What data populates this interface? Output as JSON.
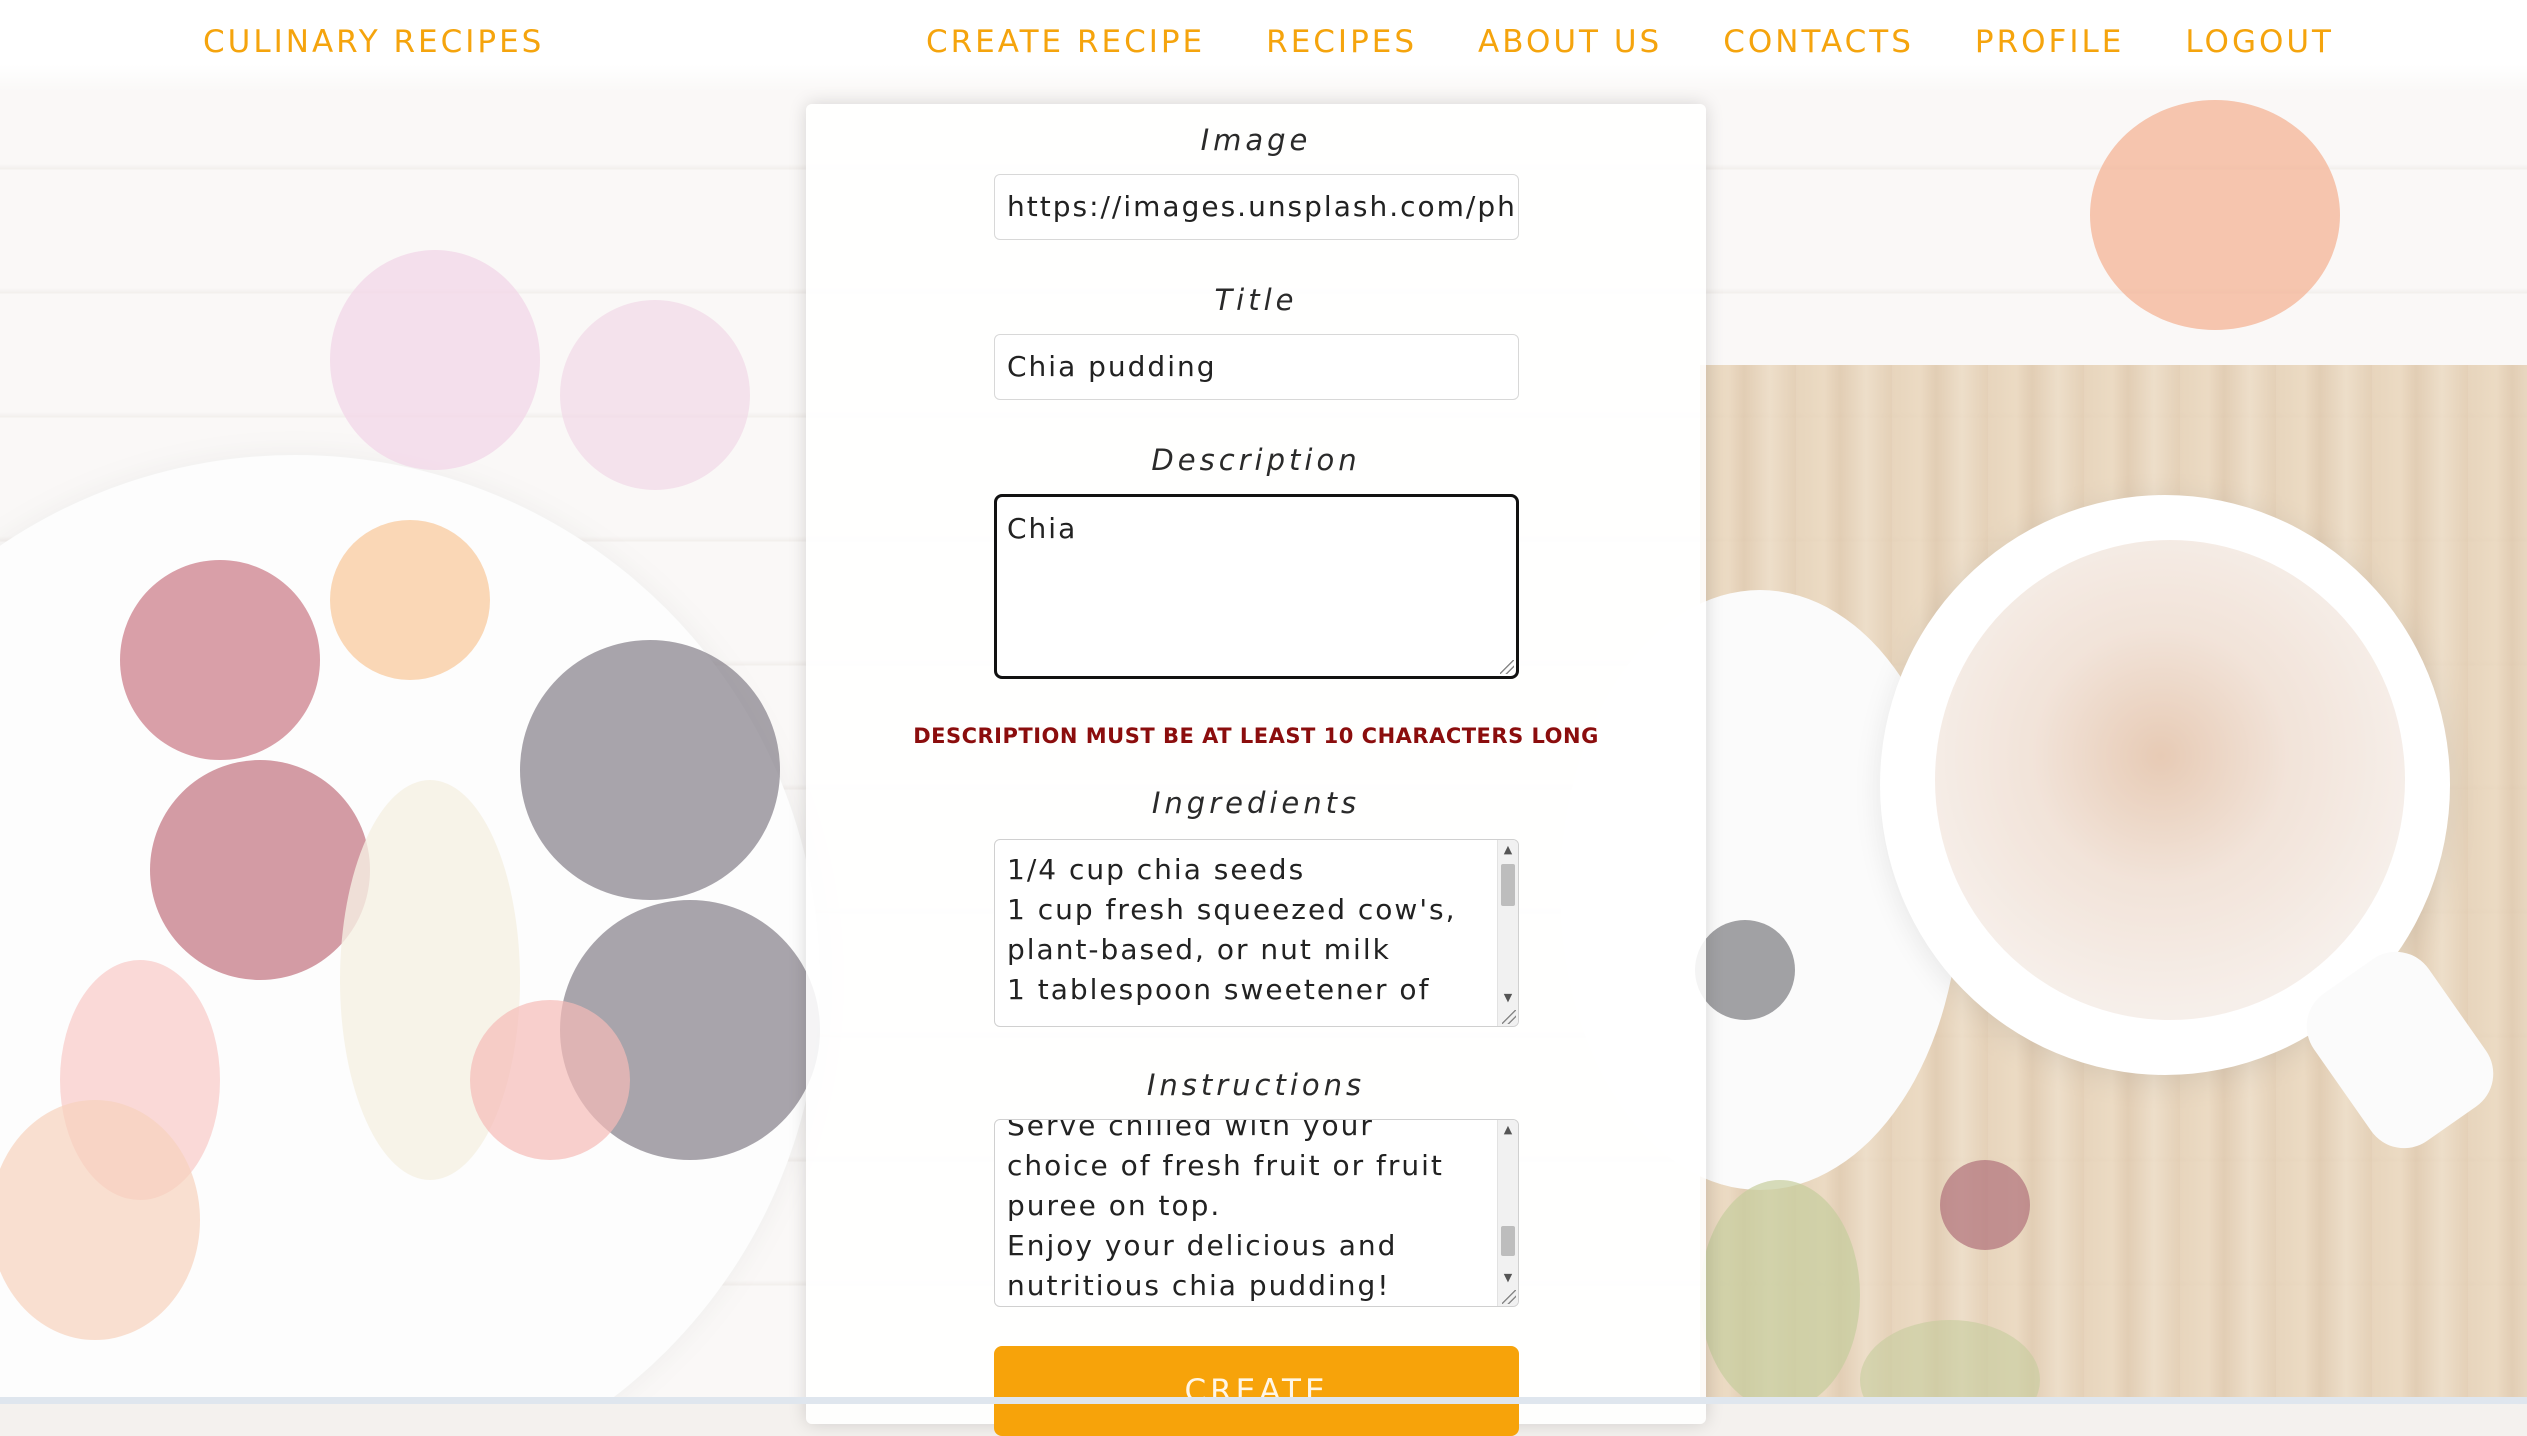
{
  "nav": {
    "brand": "CULINARY RECIPES",
    "links": [
      "CREATE RECIPE",
      "RECIPES",
      "ABOUT US",
      "CONTACTS",
      "PROFILE",
      "LOGOUT"
    ],
    "accent_color": "#f5a40d"
  },
  "form": {
    "image": {
      "label": "Image",
      "value": "https://images.unsplash.com/ph"
    },
    "title": {
      "label": "Title",
      "value": "Chia pudding"
    },
    "description": {
      "label": "Description",
      "value": "Chia",
      "error": "DESCRIPTION MUST BE AT LEAST 10 CHARACTERS LONG",
      "error_color": "#8b0d0d"
    },
    "ingredients": {
      "label": "Ingredients",
      "value": "1/4 cup chia seeds\n1 cup fresh squeezed cow's, plant-based, or nut milk\n1 tablespoon sweetener of"
    },
    "instructions": {
      "label": "Instructions",
      "value": "Serve chilled with your choice of fresh fruit or fruit puree on top.\nEnjoy your delicious and nutritious chia pudding!"
    },
    "submit": {
      "label": "CREATE",
      "color": "#f7a30a"
    }
  },
  "icons": {
    "scroll_up": "scroll-up-arrow-icon",
    "scroll_down": "scroll-down-arrow-icon",
    "resize": "resize-grip-icon"
  }
}
